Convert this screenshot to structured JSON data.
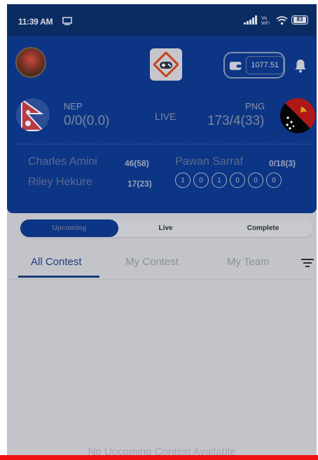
{
  "status_bar": {
    "time": "11:39 AM",
    "battery": "83"
  },
  "header": {
    "wallet_amount": "1077.51",
    "live_label": "LIVE",
    "team_left": {
      "name": "NEP",
      "score": "0/0(0.0)"
    },
    "team_right": {
      "name": "PNG",
      "score": "173/4(33)"
    },
    "batters": [
      {
        "name": "Charles Amini",
        "stat": "46(58)"
      },
      {
        "name": "Riley Hekure",
        "stat": "17(23)"
      }
    ],
    "bowler": {
      "name": "Pawan Sarraf",
      "stat": "0/18(3)"
    },
    "balls": [
      "1",
      "0",
      "1",
      "0",
      "0",
      "0"
    ]
  },
  "segment_tabs": {
    "upcoming": "Upcoming",
    "live": "Live",
    "complete": "Complete"
  },
  "contest_tabs": {
    "all": "All Contest",
    "my_contest": "My Contest",
    "my_team": "My Team"
  },
  "empty_message": "No Upcoming Contest Available",
  "colors": {
    "primary": "#0d3585",
    "background": "#c3c4ca",
    "accent_bar": "#ee1111"
  }
}
